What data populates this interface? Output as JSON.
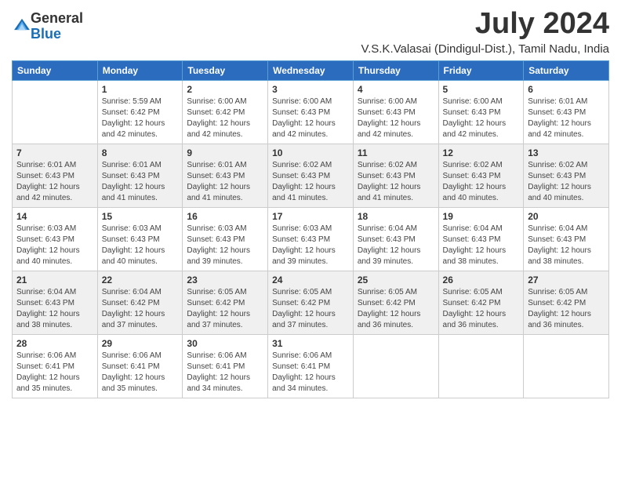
{
  "logo": {
    "general": "General",
    "blue": "Blue"
  },
  "header": {
    "month_year": "July 2024",
    "location": "V.S.K.Valasai (Dindigul-Dist.), Tamil Nadu, India"
  },
  "weekdays": [
    "Sunday",
    "Monday",
    "Tuesday",
    "Wednesday",
    "Thursday",
    "Friday",
    "Saturday"
  ],
  "weeks": [
    [
      {
        "day": "",
        "info": ""
      },
      {
        "day": "1",
        "info": "Sunrise: 5:59 AM\nSunset: 6:42 PM\nDaylight: 12 hours\nand 42 minutes."
      },
      {
        "day": "2",
        "info": "Sunrise: 6:00 AM\nSunset: 6:42 PM\nDaylight: 12 hours\nand 42 minutes."
      },
      {
        "day": "3",
        "info": "Sunrise: 6:00 AM\nSunset: 6:43 PM\nDaylight: 12 hours\nand 42 minutes."
      },
      {
        "day": "4",
        "info": "Sunrise: 6:00 AM\nSunset: 6:43 PM\nDaylight: 12 hours\nand 42 minutes."
      },
      {
        "day": "5",
        "info": "Sunrise: 6:00 AM\nSunset: 6:43 PM\nDaylight: 12 hours\nand 42 minutes."
      },
      {
        "day": "6",
        "info": "Sunrise: 6:01 AM\nSunset: 6:43 PM\nDaylight: 12 hours\nand 42 minutes."
      }
    ],
    [
      {
        "day": "7",
        "info": "Sunrise: 6:01 AM\nSunset: 6:43 PM\nDaylight: 12 hours\nand 42 minutes."
      },
      {
        "day": "8",
        "info": "Sunrise: 6:01 AM\nSunset: 6:43 PM\nDaylight: 12 hours\nand 41 minutes."
      },
      {
        "day": "9",
        "info": "Sunrise: 6:01 AM\nSunset: 6:43 PM\nDaylight: 12 hours\nand 41 minutes."
      },
      {
        "day": "10",
        "info": "Sunrise: 6:02 AM\nSunset: 6:43 PM\nDaylight: 12 hours\nand 41 minutes."
      },
      {
        "day": "11",
        "info": "Sunrise: 6:02 AM\nSunset: 6:43 PM\nDaylight: 12 hours\nand 41 minutes."
      },
      {
        "day": "12",
        "info": "Sunrise: 6:02 AM\nSunset: 6:43 PM\nDaylight: 12 hours\nand 40 minutes."
      },
      {
        "day": "13",
        "info": "Sunrise: 6:02 AM\nSunset: 6:43 PM\nDaylight: 12 hours\nand 40 minutes."
      }
    ],
    [
      {
        "day": "14",
        "info": "Sunrise: 6:03 AM\nSunset: 6:43 PM\nDaylight: 12 hours\nand 40 minutes."
      },
      {
        "day": "15",
        "info": "Sunrise: 6:03 AM\nSunset: 6:43 PM\nDaylight: 12 hours\nand 40 minutes."
      },
      {
        "day": "16",
        "info": "Sunrise: 6:03 AM\nSunset: 6:43 PM\nDaylight: 12 hours\nand 39 minutes."
      },
      {
        "day": "17",
        "info": "Sunrise: 6:03 AM\nSunset: 6:43 PM\nDaylight: 12 hours\nand 39 minutes."
      },
      {
        "day": "18",
        "info": "Sunrise: 6:04 AM\nSunset: 6:43 PM\nDaylight: 12 hours\nand 39 minutes."
      },
      {
        "day": "19",
        "info": "Sunrise: 6:04 AM\nSunset: 6:43 PM\nDaylight: 12 hours\nand 38 minutes."
      },
      {
        "day": "20",
        "info": "Sunrise: 6:04 AM\nSunset: 6:43 PM\nDaylight: 12 hours\nand 38 minutes."
      }
    ],
    [
      {
        "day": "21",
        "info": "Sunrise: 6:04 AM\nSunset: 6:43 PM\nDaylight: 12 hours\nand 38 minutes."
      },
      {
        "day": "22",
        "info": "Sunrise: 6:04 AM\nSunset: 6:42 PM\nDaylight: 12 hours\nand 37 minutes."
      },
      {
        "day": "23",
        "info": "Sunrise: 6:05 AM\nSunset: 6:42 PM\nDaylight: 12 hours\nand 37 minutes."
      },
      {
        "day": "24",
        "info": "Sunrise: 6:05 AM\nSunset: 6:42 PM\nDaylight: 12 hours\nand 37 minutes."
      },
      {
        "day": "25",
        "info": "Sunrise: 6:05 AM\nSunset: 6:42 PM\nDaylight: 12 hours\nand 36 minutes."
      },
      {
        "day": "26",
        "info": "Sunrise: 6:05 AM\nSunset: 6:42 PM\nDaylight: 12 hours\nand 36 minutes."
      },
      {
        "day": "27",
        "info": "Sunrise: 6:05 AM\nSunset: 6:42 PM\nDaylight: 12 hours\nand 36 minutes."
      }
    ],
    [
      {
        "day": "28",
        "info": "Sunrise: 6:06 AM\nSunset: 6:41 PM\nDaylight: 12 hours\nand 35 minutes."
      },
      {
        "day": "29",
        "info": "Sunrise: 6:06 AM\nSunset: 6:41 PM\nDaylight: 12 hours\nand 35 minutes."
      },
      {
        "day": "30",
        "info": "Sunrise: 6:06 AM\nSunset: 6:41 PM\nDaylight: 12 hours\nand 34 minutes."
      },
      {
        "day": "31",
        "info": "Sunrise: 6:06 AM\nSunset: 6:41 PM\nDaylight: 12 hours\nand 34 minutes."
      },
      {
        "day": "",
        "info": ""
      },
      {
        "day": "",
        "info": ""
      },
      {
        "day": "",
        "info": ""
      }
    ]
  ]
}
